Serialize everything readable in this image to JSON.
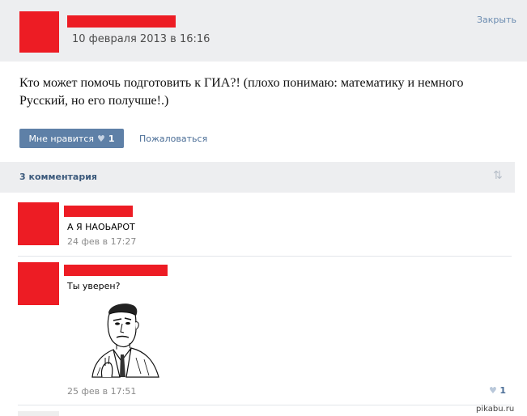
{
  "post": {
    "date": "10 февраля 2013 в 16:16",
    "close_label": "Закрыть",
    "text": "Кто может помочь подготовить к ГИА?! (плохо понимаю: математику и немного Русский, но его получше!.)",
    "like_label": "Мне нравится",
    "like_icon": "heart-icon",
    "like_count": "1",
    "report_label": "Пожаловаться"
  },
  "comments_header": {
    "label": "3 комментария",
    "sort_icon": "sort-arrows-icon"
  },
  "comments": [
    {
      "text": "А Я НАОЬАРОТ",
      "date": "24 фев в 17:27"
    },
    {
      "text": "Ты уверен?",
      "date": "25 фев в 17:51",
      "image": "are-you-sure-meme-face",
      "like_count": "1"
    }
  ],
  "watermark": "pikabu.ru",
  "colors": {
    "redaction": "#ed1c24",
    "header_bg": "#edeef0",
    "like_button_bg": "#5e80a7",
    "link": "#4a6d96"
  }
}
